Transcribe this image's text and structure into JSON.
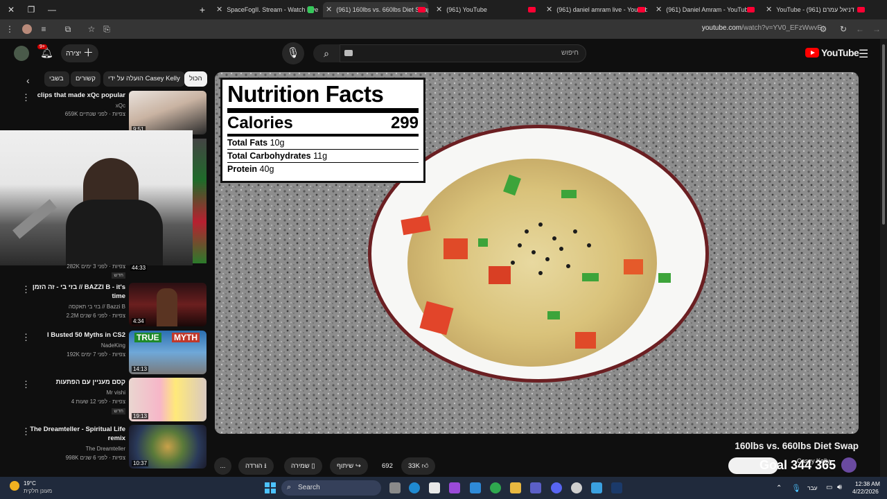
{
  "browser": {
    "tabs": [
      {
        "label": "SpaceFogII. Stream - Watch Live"
      },
      {
        "label": "(961) 160lbs vs. 660lbs Diet Swap"
      },
      {
        "label": "(961) YouTube"
      },
      {
        "label": "(961) daniel amram live - YouTube"
      },
      {
        "label": "(961) Daniel Amram - YouTube"
      },
      {
        "label": "YouTube - דניאל עמרם (961)"
      }
    ],
    "url_domain": "youtube.com",
    "url_path": "/watch?v=YV0_EFzWwvE"
  },
  "header": {
    "create_label": "יצירה",
    "notifications_badge": "9+",
    "search_placeholder": "חיפוש",
    "logo_text": "YouTube"
  },
  "chips": [
    "הכול",
    "הועלה על ידי Casey Kelly",
    "קשורים",
    "בשבי"
  ],
  "recommendations": [
    {
      "title": "clips that made xQc popular",
      "channel": "xQc",
      "meta": "659K צפיות · לפני שנתיים",
      "duration": "9:51",
      "badge": ""
    },
    {
      "title": "",
      "channel": "",
      "meta": "282K צפיות · לפני 3 ימים",
      "duration": "44:33",
      "badge": "חדש"
    },
    {
      "title": "בזי בי - זה הזמן // BAZZI B - it's time",
      "channel": "בזי בי תאקסה // Bazzi B",
      "meta": "2.2M צפיות · לפני 6 שנים",
      "duration": "4:34",
      "badge": ""
    },
    {
      "title": "I Busted 50 Myths in CS2",
      "channel": "NadeKing",
      "meta": "192K צפיות · לפני 7 ימים",
      "duration": "14:13",
      "badge": ""
    },
    {
      "title": "קסם מעניין עם הפתעות",
      "channel": "Mr vishi",
      "meta": "4 צפיות · לפני 12 שעות",
      "duration": "19:13",
      "badge": "חדש"
    },
    {
      "title": "The Dreamteller - Spiritual Life remix",
      "channel": "The Dreamteller",
      "meta": "998K צפיות · לפני 6 שנים",
      "duration": "10:37",
      "badge": ""
    }
  ],
  "nutrition": {
    "heading": "Nutrition Facts",
    "calories_label": "Calories",
    "calories_value": "299",
    "fats_label": "Total Fats",
    "fats_value": "10g",
    "carbs_label": "Total Carbohydrates",
    "carbs_value": "11g",
    "protein_label": "Protein",
    "protein_value": "40g"
  },
  "thumb_labels": {
    "true": "TRUE",
    "myth": "MYTH"
  },
  "video": {
    "title": "160lbs vs. 660lbs Diet Swap",
    "channel": "Casey Kelly",
    "overlay_text": "Goal 344 365",
    "likes": "33K",
    "comments": "692",
    "share": "שיתוף",
    "save": "שמירה",
    "download": "הורדה",
    "more": "..."
  },
  "taskbar": {
    "search_label": "Search",
    "weather_temp": "19°C",
    "weather_desc": "מעונן חלקית",
    "time": "12:38 AM",
    "date": "4/22/2026",
    "lang": "עבר"
  }
}
